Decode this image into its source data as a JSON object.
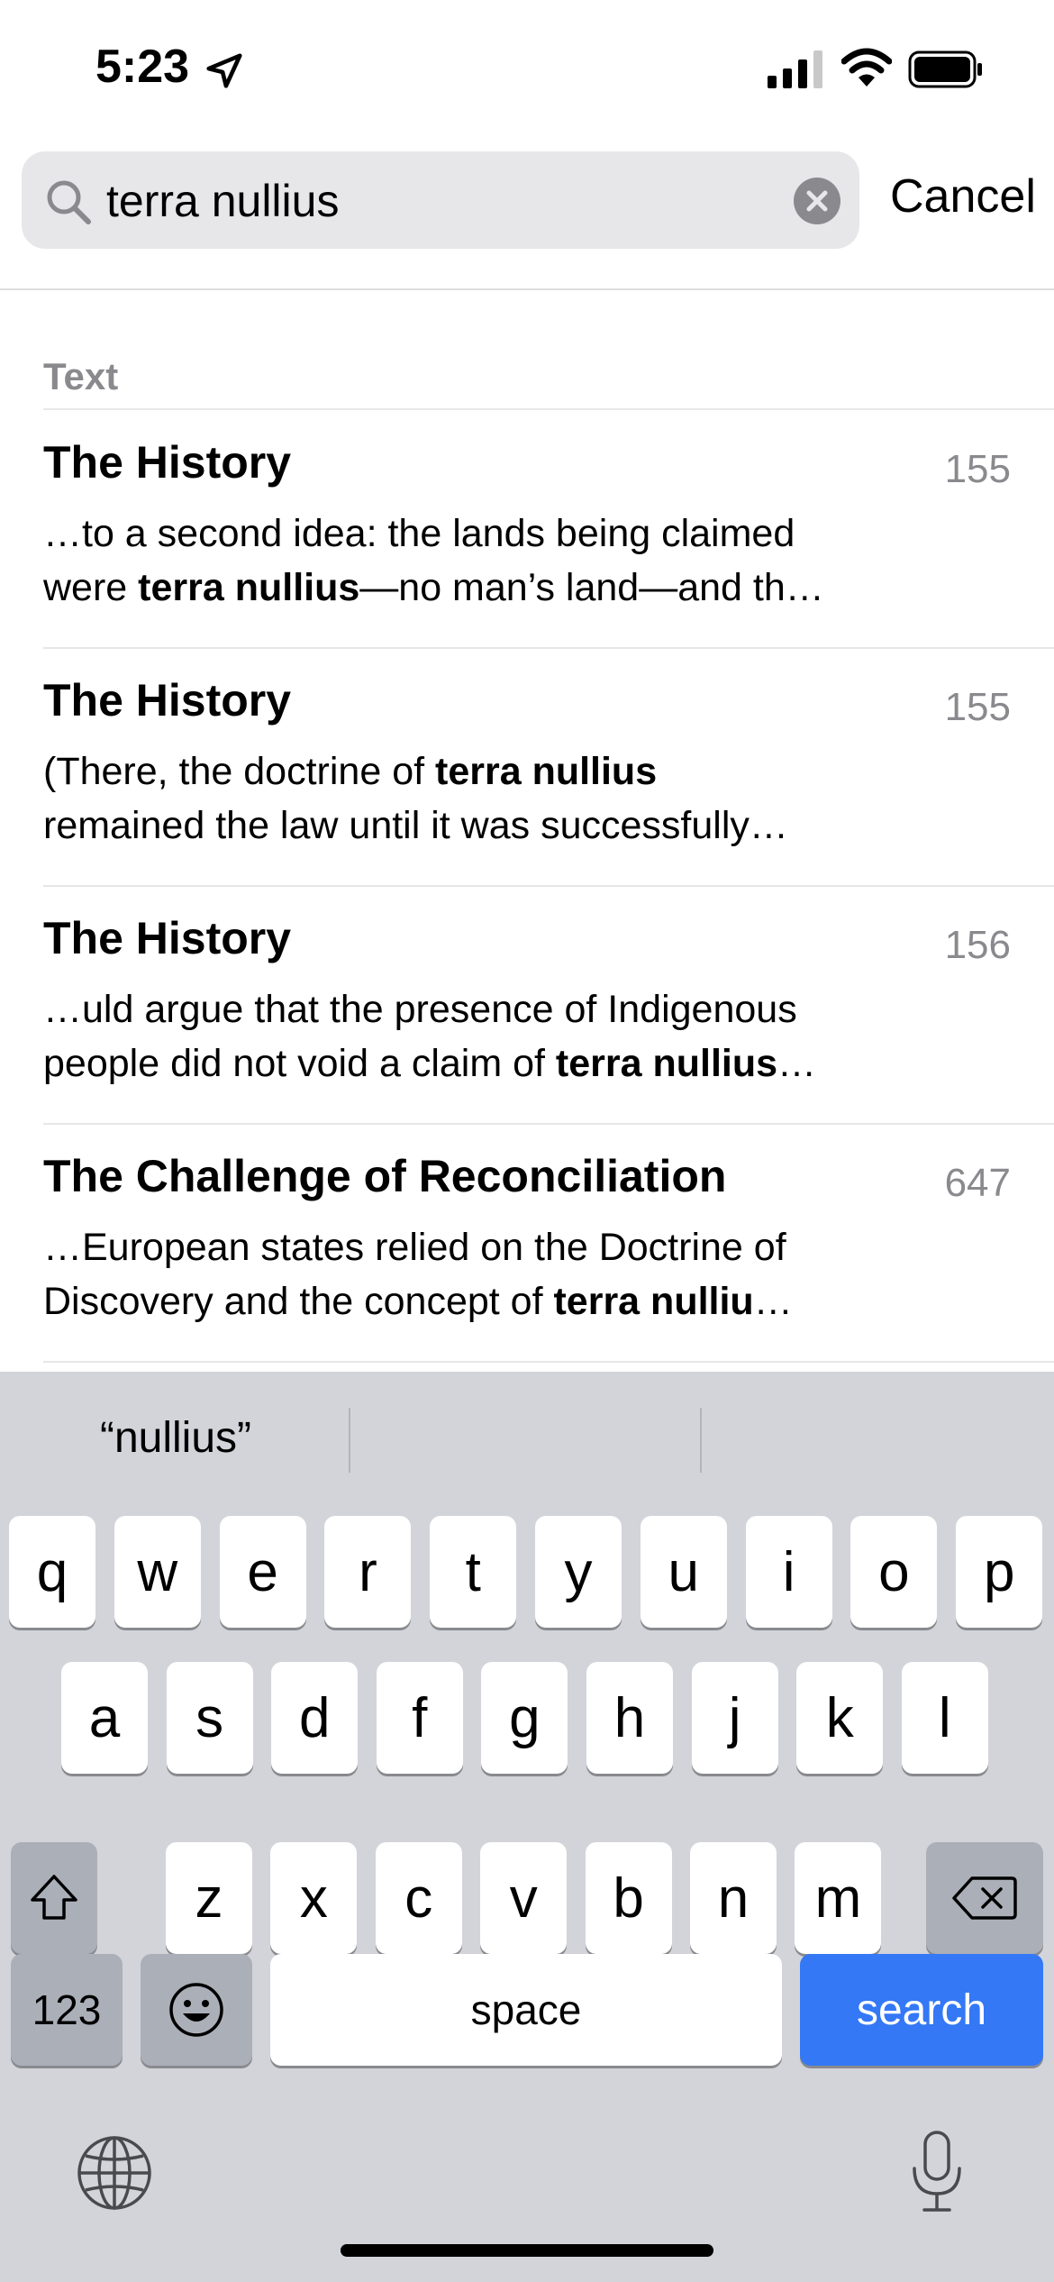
{
  "status_bar": {
    "time": "5:23",
    "icons": [
      "location-arrow-icon",
      "cellular-signal-icon",
      "wifi-icon",
      "battery-icon"
    ]
  },
  "search": {
    "query": "terra nullius",
    "cancel_label": "Cancel",
    "icons": [
      "search-icon",
      "clear-icon"
    ]
  },
  "section": {
    "label": "Text"
  },
  "results": [
    {
      "title": "The History",
      "page": "155",
      "line1_pre": "…to a second idea: the lands being claimed",
      "line2_pre": "were ",
      "line2_bold": "terra nullius",
      "line2_post": "—no man’s land—and th…"
    },
    {
      "title": "The History",
      "page": "155",
      "line1_pre": "(There, the doctrine of ",
      "line1_bold": "terra nullius",
      "line2_pre": "remained the law until it was successfully…"
    },
    {
      "title": "The History",
      "page": "156",
      "line1_pre": "…uld argue that the presence of Indigenous",
      "line2_pre": "people did not void a claim of ",
      "line2_bold": "terra nullius",
      "line2_post": "…"
    },
    {
      "title": "The Challenge of Reconciliation",
      "page": "647",
      "line1_pre": "…European states relied on the Doctrine of",
      "line2_pre": "Discovery and the concept of ",
      "line2_bold": "terra nulliu",
      "line2_post": "…"
    }
  ],
  "keyboard": {
    "suggestions": [
      "“nullius”",
      "",
      ""
    ],
    "row1": [
      "q",
      "w",
      "e",
      "r",
      "t",
      "y",
      "u",
      "i",
      "o",
      "p"
    ],
    "row2": [
      "a",
      "s",
      "d",
      "f",
      "g",
      "h",
      "j",
      "k",
      "l"
    ],
    "row3": [
      "z",
      "x",
      "c",
      "v",
      "b",
      "n",
      "m"
    ],
    "numbers_label": "123",
    "space_label": "space",
    "search_label": "search",
    "icons": [
      "shift-icon",
      "delete-icon",
      "emoji-icon",
      "globe-icon",
      "microphone-icon"
    ],
    "accent_color": "#3478f6"
  }
}
